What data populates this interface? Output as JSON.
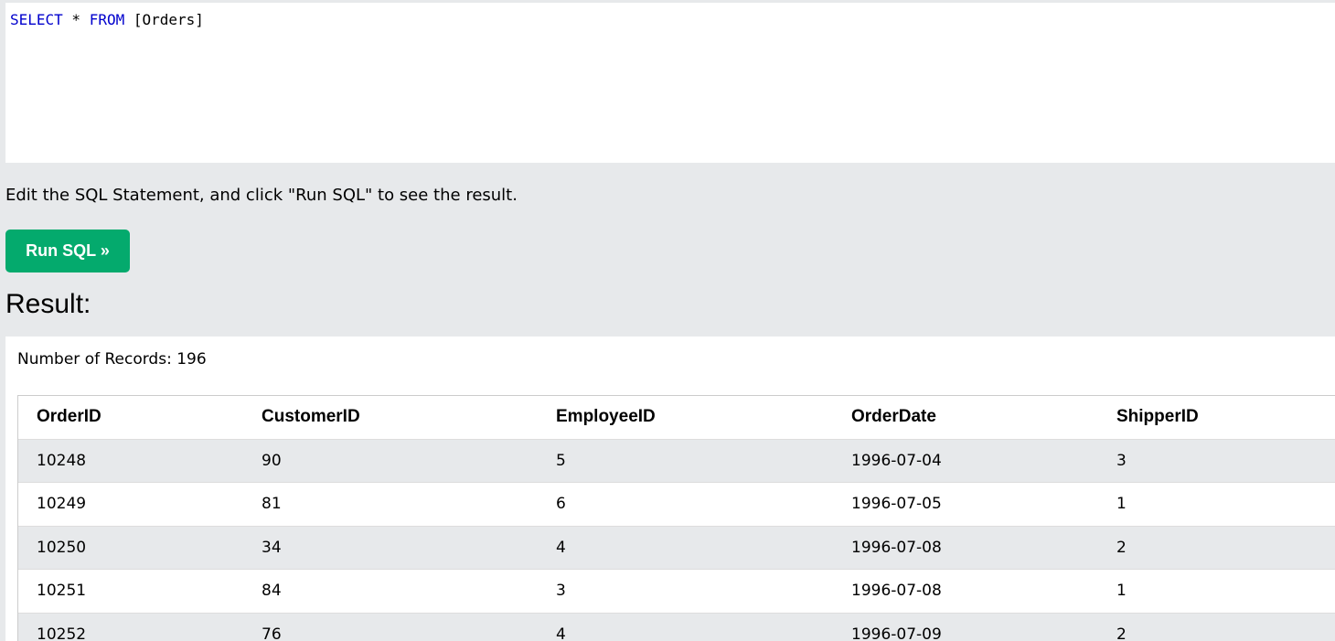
{
  "editor": {
    "tokens": [
      {
        "text": "SELECT",
        "type": "keyword"
      },
      {
        "text": " * ",
        "type": "plain"
      },
      {
        "text": "FROM",
        "type": "keyword"
      },
      {
        "text": " [Orders]",
        "type": "plain"
      }
    ]
  },
  "instructions": "Edit the SQL Statement, and click \"Run SQL\" to see the result.",
  "run_button_label": "Run SQL »",
  "result_title": "Result:",
  "record_count": "Number of Records: 196",
  "table": {
    "columns": [
      "OrderID",
      "CustomerID",
      "EmployeeID",
      "OrderDate",
      "ShipperID"
    ],
    "rows": [
      [
        "10248",
        "90",
        "5",
        "1996-07-04",
        "3"
      ],
      [
        "10249",
        "81",
        "6",
        "1996-07-05",
        "1"
      ],
      [
        "10250",
        "34",
        "4",
        "1996-07-08",
        "2"
      ],
      [
        "10251",
        "84",
        "3",
        "1996-07-08",
        "1"
      ],
      [
        "10252",
        "76",
        "4",
        "1996-07-09",
        "2"
      ]
    ]
  },
  "colors": {
    "button": "#04aa6d",
    "keyword": "#0000cd",
    "background": "#e7e9eb"
  }
}
